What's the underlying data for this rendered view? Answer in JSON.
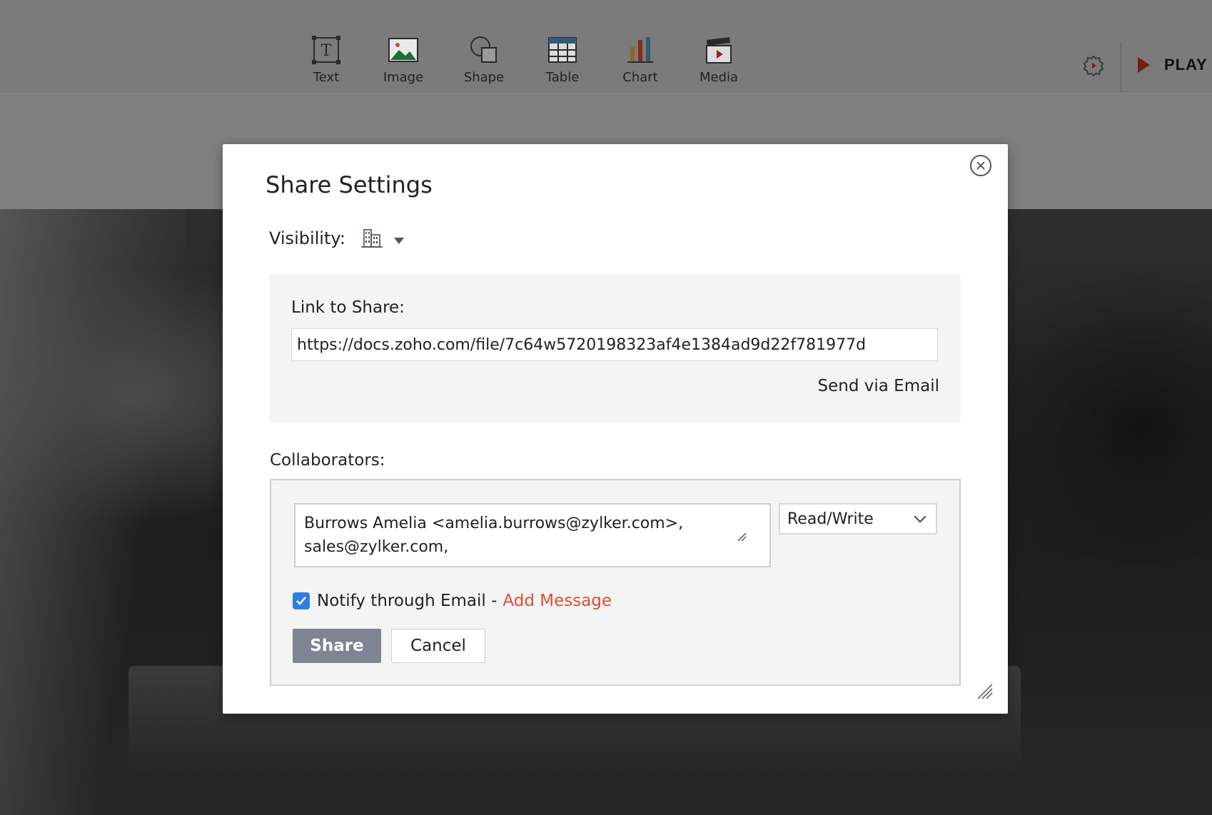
{
  "toolbar": {
    "items": [
      {
        "label": "Text",
        "icon": "text-box-icon"
      },
      {
        "label": "Image",
        "icon": "image-icon"
      },
      {
        "label": "Shape",
        "icon": "shape-icon"
      },
      {
        "label": "Table",
        "icon": "table-icon"
      },
      {
        "label": "Chart",
        "icon": "bar-chart-icon"
      },
      {
        "label": "Media",
        "icon": "clapperboard-icon"
      }
    ],
    "play_label": "PLAY"
  },
  "dialog": {
    "title": "Share Settings",
    "visibility_label": "Visibility:",
    "visibility_icon": "organization-building-icon",
    "link_label": "Link to Share:",
    "link_value": "https://docs.zoho.com/file/7c64w5720198323af4e1384ad9d22f781977d",
    "send_via_email": "Send via Email",
    "collaborators_label": "Collaborators:",
    "collaborators_value": "Burrows Amelia <amelia.burrows@zylker.com>,\nsales@zylker.com,",
    "permission": "Read/Write",
    "notify_checked": true,
    "notify_label": "Notify through Email -",
    "add_message": "Add Message",
    "share_label": "Share",
    "cancel_label": "Cancel"
  },
  "colors": {
    "accent_red": "#e14b35",
    "checkbox_blue": "#2f7fe0",
    "share_button": "#7e8491",
    "play_icon": "#7a1d17"
  }
}
